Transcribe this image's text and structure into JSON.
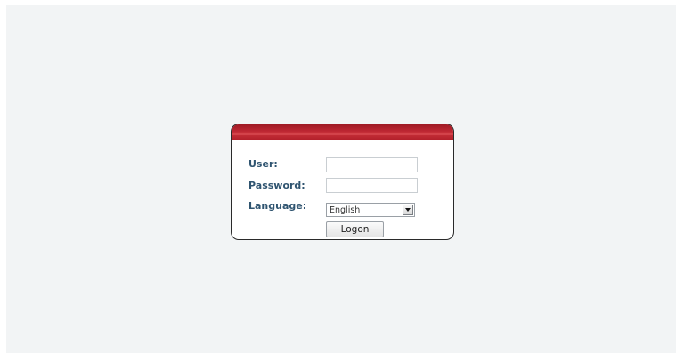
{
  "login": {
    "user_label": "User:",
    "user_value": "",
    "password_label": "Password:",
    "password_value": "",
    "language_label": "Language:",
    "language_selected": "English",
    "logon_button": "Logon"
  },
  "colors": {
    "header_red": "#b82430",
    "label_blue": "#2f5470",
    "page_background": "#f2f4f5"
  },
  "icons": {
    "language_dropdown": "chevron-down-icon"
  }
}
